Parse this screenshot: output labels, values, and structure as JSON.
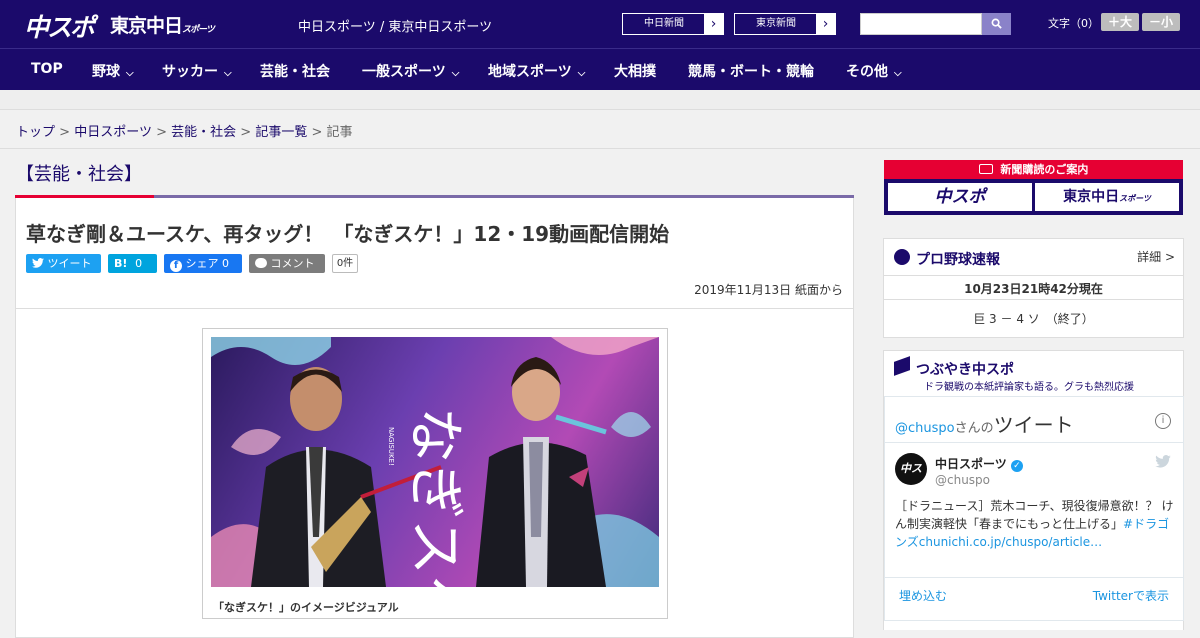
{
  "header": {
    "logo_chuspo": "中スポ",
    "logo_tokyo": "東京中日",
    "logo_tokyo_small": "スポーツ",
    "site_links": "中日スポーツ / 東京中日スポーツ",
    "chunichi_button": "中日新聞",
    "tokyo_button": "東京新聞",
    "arrow": "›",
    "search_placeholder": "",
    "font_size_label": "文字（0）",
    "font_plus": "＋大",
    "font_minus": "－小",
    "colors": {
      "brand": "#1b0a6b",
      "accent": "#e60033"
    }
  },
  "nav": {
    "items": [
      {
        "label": "TOP",
        "chevron": false
      },
      {
        "label": "野球",
        "chevron": true
      },
      {
        "label": "サッカー",
        "chevron": true
      },
      {
        "label": "芸能・社会",
        "chevron": false
      },
      {
        "label": "一般スポーツ",
        "chevron": true
      },
      {
        "label": "地域スポーツ",
        "chevron": true
      },
      {
        "label": "大相撲",
        "chevron": false
      },
      {
        "label": "競馬・ボート・競輪",
        "chevron": false
      },
      {
        "label": "その他",
        "chevron": true
      }
    ]
  },
  "breadcrumb": {
    "items": [
      "トップ",
      "中日スポーツ",
      "芸能・社会",
      "記事一覧"
    ],
    "current": "記事",
    "separator": ">"
  },
  "section": {
    "title": "【芸能・社会】"
  },
  "article": {
    "headline": "草なぎ剛＆ユースケ、再タッグ！　「なぎスケ！」12・19動画配信開始",
    "share": {
      "tweet": "ツイート",
      "hatena": "B!",
      "hatena_count": "0",
      "facebook": "シェア",
      "facebook_count": "0",
      "comment": "コメント",
      "comment_count": "0件"
    },
    "date": "2019年11月13日 紙面から",
    "image_title": "なぎスケ",
    "image_sub": "NAGISUKE!",
    "caption": "「なぎスケ！」のイメージビジュアル"
  },
  "sidebar": {
    "promo": {
      "header": "新聞購読のご案内",
      "left": "中スポ",
      "right": "東京中日",
      "right_small": "スポーツ"
    },
    "baseball": {
      "title": "プロ野球速報",
      "detail": "詳細 >",
      "timestamp": "10月23日21時42分現在",
      "score": "巨 3 － 4 ソ　（終了）"
    },
    "tweets": {
      "title": "つぶやき中スポ",
      "subtitle": "ドラ観戦の本紙評論家も語る。グラも熱烈応援",
      "embed_header_handle": "@chuspo",
      "embed_header_suffix": "さんの",
      "embed_header_label": "ツイート",
      "author_name": "中日スポーツ",
      "author_handle": "@chuspo",
      "tweet_text": "［ドラニュース］荒木コーチ、現役復帰意欲！？ けん制実演軽快「春までにもっと仕上げる」",
      "tweet_link": "#ドラゴンズchunichi.co.jp/chuspo/article…",
      "embed": "埋め込む",
      "view_on_twitter": "Twitterで表示"
    }
  }
}
